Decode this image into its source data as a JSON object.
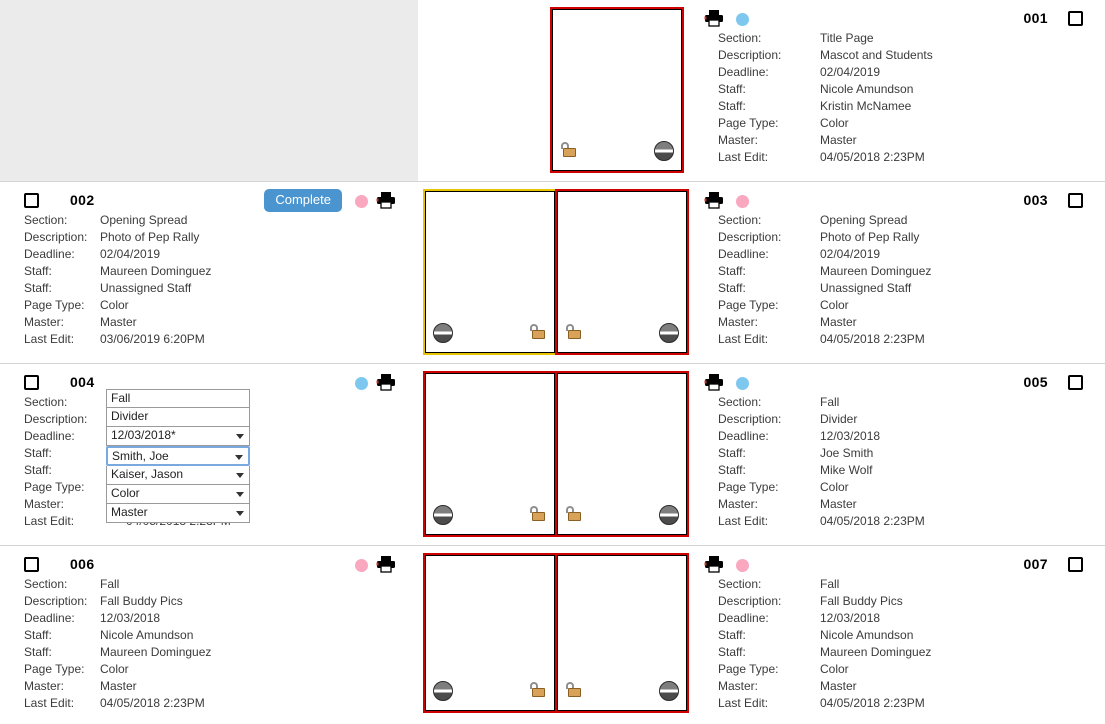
{
  "labels": {
    "section": "Section:",
    "description": "Description:",
    "deadline": "Deadline:",
    "staff": "Staff:",
    "staff2": "Staff:",
    "page_type": "Page Type:",
    "master": "Master:",
    "last_edit": "Last Edit:"
  },
  "colors": {
    "complete_button": "#4a94cf",
    "dot_blue": "#7ec8f0",
    "dot_pink": "#f9a8c0",
    "border_red": "#cf0000",
    "border_yellow": "#e8c400",
    "border_black": "#000000",
    "blank_background": "#ebebeb",
    "row_divider": "#d4d4d4"
  },
  "icons": {
    "printer": "printer-icon",
    "status_dot": "status-dot-icon",
    "lock": "unlocked-padlock-icon",
    "circle": "no-entry-circle-icon",
    "checkbox": "select-checkbox",
    "dropdown_arrow": "chevron-down-icon"
  },
  "rows": [
    {
      "id": "row-001",
      "layout": "single",
      "left": {
        "blank": true
      },
      "pages": [
        {
          "side": "right",
          "border": "red",
          "lock": "unlocked",
          "circle": true
        }
      ],
      "right": {
        "page_number": "001",
        "dot": "blue",
        "checkbox": false,
        "complete_button": null,
        "fields": {
          "section": "Title Page",
          "description": "Mascot and Students",
          "deadline": "02/04/2019",
          "staff": "Nicole Amundson",
          "staff2": "Kristin McNamee",
          "page_type": "Color",
          "master": "Master",
          "last_edit": "04/05/2018 2:23PM"
        }
      }
    },
    {
      "id": "row-002-003",
      "layout": "spread",
      "left": {
        "page_number": "002",
        "dot": "pink",
        "checkbox": false,
        "complete_button": "Complete",
        "fields": {
          "section": "Opening Spread",
          "description": "Photo of Pep Rally",
          "deadline": "02/04/2019",
          "staff": "Maureen Dominguez",
          "staff2": "Unassigned Staff",
          "page_type": "Color",
          "master": "Master",
          "last_edit": "03/06/2019 6:20PM"
        }
      },
      "pages": [
        {
          "side": "left",
          "border": "yellow",
          "lock": "unlocked",
          "circle": true
        },
        {
          "side": "right",
          "border": "red",
          "lock": "unlocked",
          "circle": true
        }
      ],
      "right": {
        "page_number": "003",
        "dot": "pink",
        "checkbox": false,
        "complete_button": null,
        "fields": {
          "section": "Opening Spread",
          "description": "Photo of Pep Rally",
          "deadline": "02/04/2019",
          "staff": "Maureen Dominguez",
          "staff2": "Unassigned Staff",
          "page_type": "Color",
          "master": "Master",
          "last_edit": "04/05/2018 2:23PM"
        }
      }
    },
    {
      "id": "row-004-005",
      "layout": "spread",
      "left": {
        "page_number": "004",
        "dot": "blue",
        "checkbox": false,
        "complete_button": null,
        "editing": true,
        "fields": {
          "section": "Fall",
          "description": "Divider",
          "deadline": "12/03/2018*",
          "staff": "Smith, Joe",
          "staff2": "Kaiser, Jason",
          "page_type": "Color",
          "master": "Master",
          "last_edit": "04/05/2018 2:23PM"
        },
        "focused_field": "staff"
      },
      "pages": [
        {
          "side": "left",
          "border": "red",
          "lock": "unlocked",
          "circle": true
        },
        {
          "side": "right",
          "border": "red",
          "lock": "unlocked",
          "circle": true
        }
      ],
      "right": {
        "page_number": "005",
        "dot": "blue",
        "checkbox": false,
        "complete_button": null,
        "fields": {
          "section": "Fall",
          "description": "Divider",
          "deadline": "12/03/2018",
          "staff": "Joe Smith",
          "staff2": "Mike Wolf",
          "page_type": "Color",
          "master": "Master",
          "last_edit": "04/05/2018 2:23PM"
        }
      }
    },
    {
      "id": "row-006-007",
      "layout": "spread",
      "left": {
        "page_number": "006",
        "dot": "pink",
        "checkbox": false,
        "complete_button": null,
        "fields": {
          "section": "Fall",
          "description": "Fall Buddy Pics",
          "deadline": "12/03/2018",
          "staff": "Nicole Amundson",
          "staff2": "Maureen Dominguez",
          "page_type": "Color",
          "master": "Master",
          "last_edit": "04/05/2018 2:23PM"
        }
      },
      "pages": [
        {
          "side": "left",
          "border": "red",
          "lock": "unlocked",
          "circle": true
        },
        {
          "side": "right",
          "border": "red",
          "lock": "unlocked",
          "circle": true
        }
      ],
      "right": {
        "page_number": "007",
        "dot": "pink",
        "checkbox": false,
        "complete_button": null,
        "fields": {
          "section": "Fall",
          "description": "Fall Buddy Pics",
          "deadline": "12/03/2018",
          "staff": "Nicole Amundson",
          "staff2": "Maureen Dominguez",
          "page_type": "Color",
          "master": "Master",
          "last_edit": "04/05/2018 2:23PM"
        }
      }
    }
  ]
}
